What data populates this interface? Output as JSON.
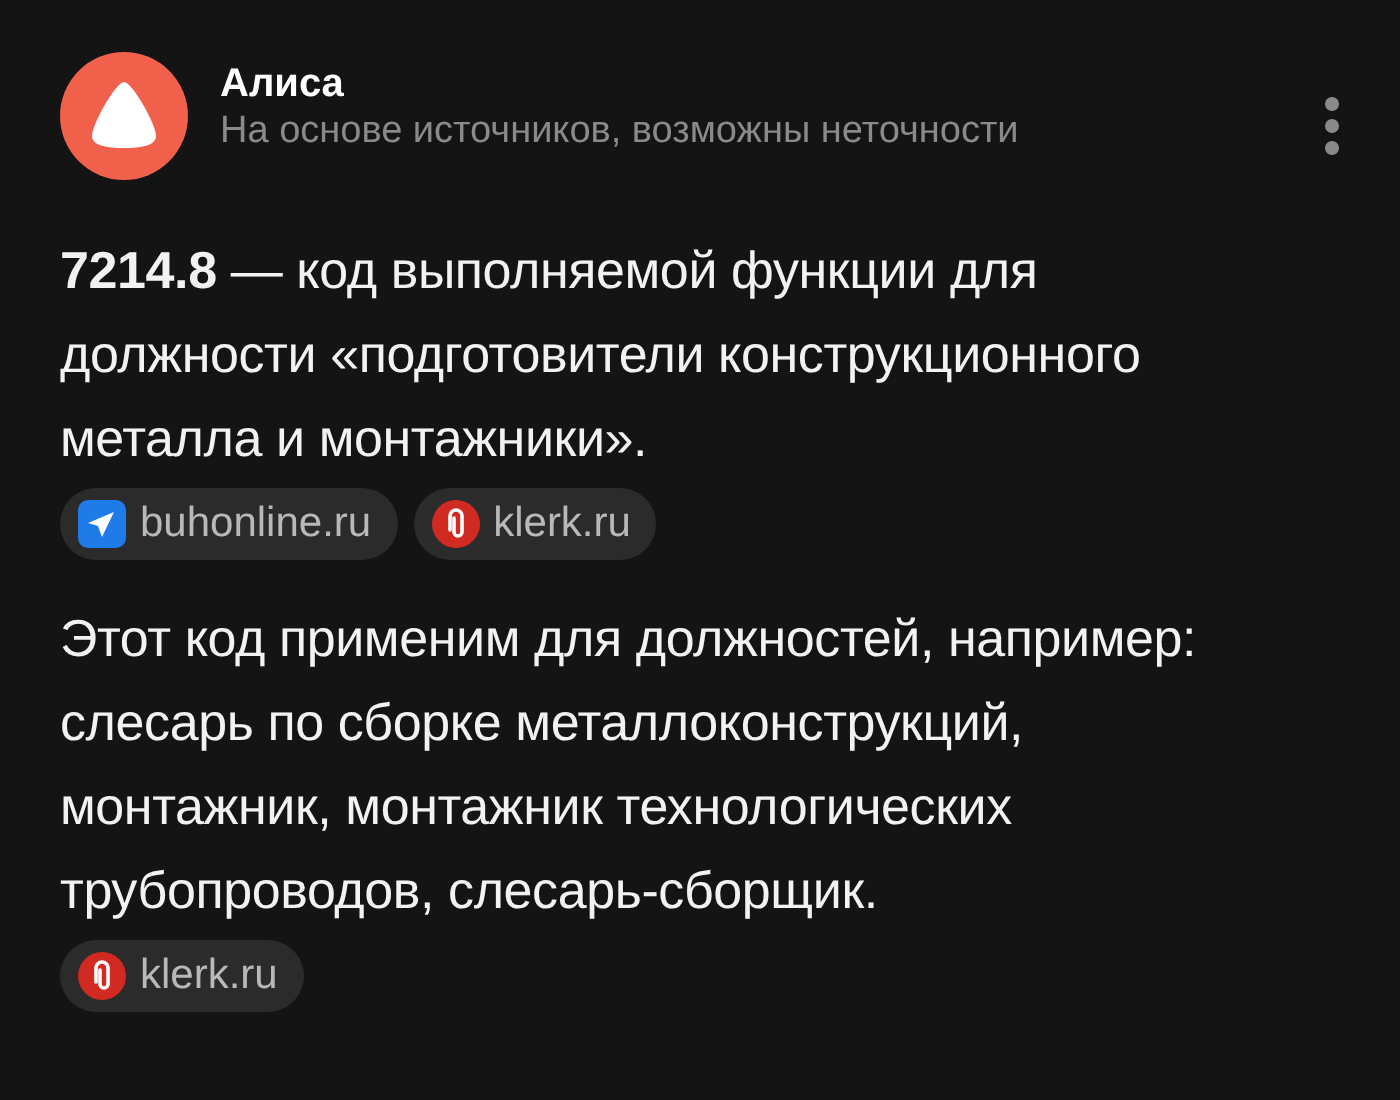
{
  "header": {
    "title": "Алиса",
    "subtitle": "На основе источников, возможны неточности"
  },
  "paragraphs": [
    {
      "text": "**7214.8** — код выполняемой функции для должности «подготовители конструкционного металла и монтажники».",
      "sources": [
        {
          "label": "buhonline.ru",
          "kind": "telegram"
        },
        {
          "label": "klerk.ru",
          "kind": "clip"
        }
      ]
    },
    {
      "text": "Этот код применим для должностей, например: слесарь по сборке металлоконструкций, монтажник, монтажник технологических трубопроводов, слесарь-сборщик.",
      "sources": [
        {
          "label": "klerk.ru",
          "kind": "clip"
        }
      ]
    }
  ]
}
